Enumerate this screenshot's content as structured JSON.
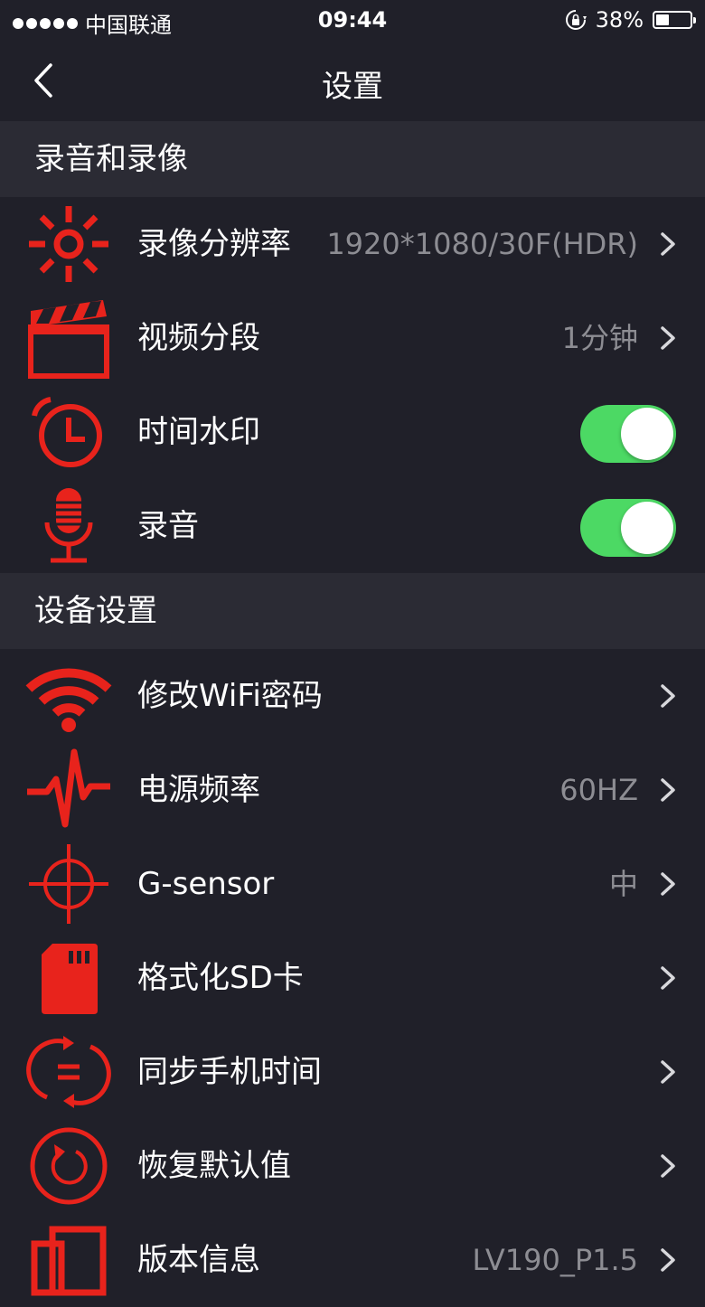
{
  "status_bar": {
    "carrier": "中国联通",
    "time": "09:44",
    "battery_percent": "38%",
    "battery_level": 0.38,
    "icons": [
      "signal-dots-icon",
      "rotation-lock-icon",
      "battery-icon"
    ]
  },
  "nav": {
    "title": "设置",
    "back_icon": "chevron-left-icon"
  },
  "sections": {
    "recording": {
      "title": "录音和录像",
      "items": [
        {
          "label": "录像分辨率",
          "value": "1920*1080/30F(HDR)",
          "icon": "sun-resolution-icon"
        },
        {
          "label": "视频分段",
          "value": "1分钟",
          "icon": "clapperboard-icon"
        },
        {
          "label": "时间水印",
          "toggle_on": true,
          "icon": "alarm-clock-icon"
        },
        {
          "label": "录音",
          "toggle_on": true,
          "icon": "microphone-icon"
        }
      ]
    },
    "device": {
      "title": "设备设置",
      "items": [
        {
          "label": "修改WiFi密码",
          "value": "",
          "icon": "wifi-icon"
        },
        {
          "label": "电源频率",
          "value": "60HZ",
          "icon": "pulse-icon"
        },
        {
          "label": "G-sensor",
          "value": "中",
          "icon": "crosshair-icon"
        },
        {
          "label": "格式化SD卡",
          "value": "",
          "icon": "sd-card-icon"
        },
        {
          "label": "同步手机时间",
          "value": "",
          "icon": "sync-icon"
        },
        {
          "label": "恢复默认值",
          "value": "",
          "icon": "restore-icon"
        },
        {
          "label": "版本信息",
          "value": "LV190_P1.5",
          "icon": "version-icon"
        }
      ]
    }
  },
  "colors": {
    "background": "#202029",
    "section_bg": "#2b2b34",
    "accent_red": "#e8231c",
    "toggle_on": "#4cd964",
    "value_gray": "#8d8d93"
  }
}
